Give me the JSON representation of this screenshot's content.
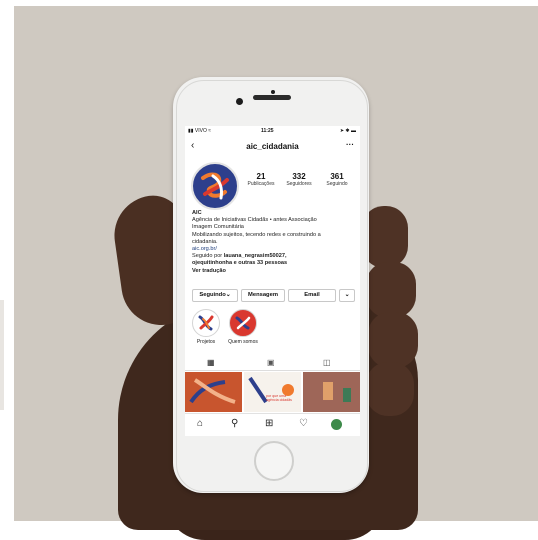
{
  "status_bar": {
    "carrier": "VIVO",
    "time": "11:25"
  },
  "profile": {
    "username": "aic_cidadania",
    "posts": {
      "count": "21",
      "label": "Publicações"
    },
    "followers": {
      "count": "332",
      "label": "Seguidores"
    },
    "following": {
      "count": "361",
      "label": "Seguindo"
    }
  },
  "bio": {
    "name": "AIC",
    "line1": "Agência de Iniciativas Cidadãs • antes Associação",
    "line2": "Imagem Comunitária",
    "line3": "Mobilizando sujeitos, tecendo redes e construindo a",
    "line4": "cidadania.",
    "link": "aic.org.br/",
    "followed_prefix": "Seguido por ",
    "followed_names": "lauana_negrasim50027,",
    "followed_line2": "ojequitinhonha e outras 33 pessoas",
    "translate": "Ver tradução"
  },
  "buttons": {
    "following": "Seguindo",
    "message": "Mensagem",
    "email": "Email",
    "more": "⌄"
  },
  "highlights": [
    {
      "label": "Projetos"
    },
    {
      "label": "Quem somos"
    }
  ],
  "grid_posts": [
    {
      "text": ""
    },
    {
      "text": "por que uma agência cidadãs"
    },
    {
      "text": ""
    }
  ],
  "colors": {
    "brand_blue": "#2d3f8c",
    "brand_red": "#d9382f",
    "brand_orange": "#f07a2e",
    "background_wall": "#cfc9c1"
  },
  "icons": {
    "back": "chevron-left-icon",
    "more": "ellipsis-icon",
    "grid_tab": "grid-icon",
    "igtv_tab": "igtv-icon",
    "tagged_tab": "tagged-icon",
    "home": "home-icon",
    "search": "search-icon",
    "add": "plus-icon",
    "activity": "heart-icon",
    "profile": "avatar"
  }
}
